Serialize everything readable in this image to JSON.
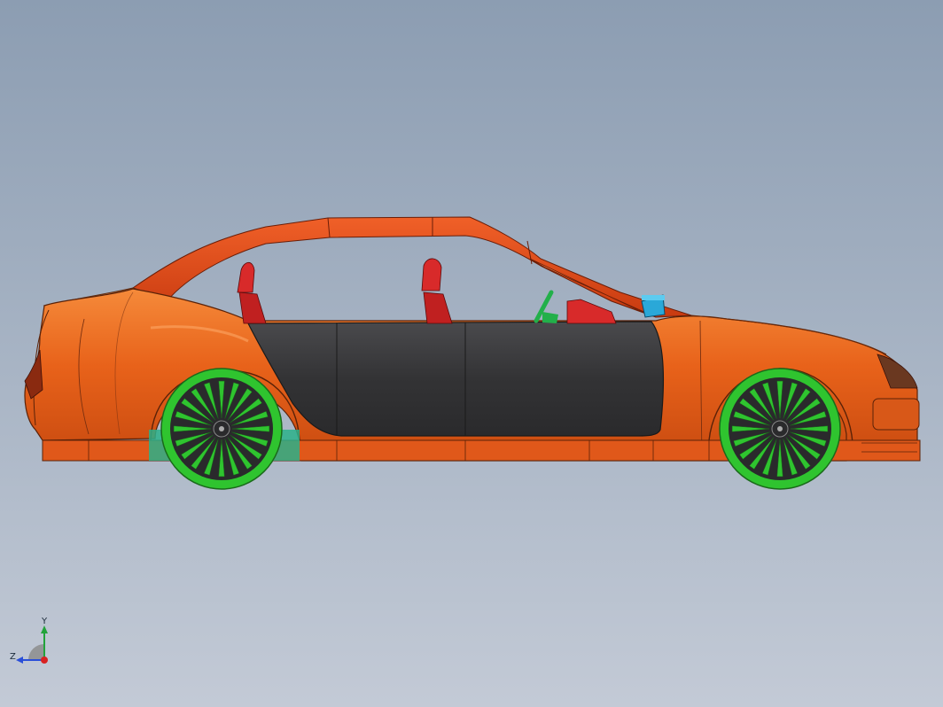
{
  "viewport": {
    "background_top": "#8c9db2",
    "background_bottom": "#c3cad6"
  },
  "model": {
    "body_color": "#e8621a",
    "roof_color": "#e04a14",
    "door_color": "#3a3a3c",
    "wheel_color": "#2fc42f",
    "seat_color": "#d82a2a",
    "mirror_color": "#2aa8d8"
  },
  "triad": {
    "y_label": "Y",
    "z_label": "Z",
    "y_color": "#22a33a",
    "z_color": "#2a4fd8",
    "x_color": "#d82222"
  }
}
